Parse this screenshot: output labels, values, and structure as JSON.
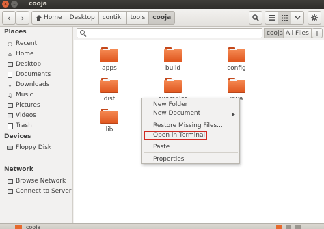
{
  "window": {
    "title": "cooja"
  },
  "toolbar": {
    "back_icon": "back-arrow-icon",
    "forward_icon": "forward-arrow-icon",
    "breadcrumbs": [
      "Home",
      "Desktop",
      "contiki",
      "tools",
      "cooja"
    ],
    "search_icon": "search-icon",
    "list_view_icon": "list-view-icon",
    "grid_view_icon": "grid-view-icon",
    "dropdown_icon": "chevron-down-icon",
    "settings_icon": "gear-icon"
  },
  "sidebar": {
    "places_title": "Places",
    "places": [
      {
        "label": "Recent",
        "icon": "clock-icon"
      },
      {
        "label": "Home",
        "icon": "home-icon"
      },
      {
        "label": "Desktop",
        "icon": "desktop-icon"
      },
      {
        "label": "Documents",
        "icon": "documents-icon"
      },
      {
        "label": "Downloads",
        "icon": "downloads-icon"
      },
      {
        "label": "Music",
        "icon": "music-icon"
      },
      {
        "label": "Pictures",
        "icon": "pictures-icon"
      },
      {
        "label": "Videos",
        "icon": "videos-icon"
      },
      {
        "label": "Trash",
        "icon": "trash-icon"
      }
    ],
    "devices_title": "Devices",
    "devices": [
      {
        "label": "Floppy Disk",
        "icon": "floppy-icon"
      }
    ],
    "network_title": "Network",
    "network": [
      {
        "label": "Browse Network",
        "icon": "network-icon"
      },
      {
        "label": "Connect to Server",
        "icon": "server-icon"
      }
    ]
  },
  "search": {
    "placeholder": "",
    "scopes": [
      "cooja",
      "All Files"
    ],
    "selected_scope": "cooja"
  },
  "folders": [
    "apps",
    "build",
    "config",
    "dist",
    "examples",
    "java",
    "lib"
  ],
  "context_menu": {
    "items": [
      {
        "label": "New Folder",
        "submenu": false
      },
      {
        "label": "New Document",
        "submenu": true
      },
      {
        "label": "Restore Missing Files...",
        "submenu": false
      },
      {
        "label": "Open in Terminal",
        "submenu": false,
        "highlighted": true
      },
      {
        "label": "Paste",
        "submenu": false
      },
      {
        "label": "Properties",
        "submenu": false
      }
    ]
  },
  "taskbar": {
    "items": [
      "cooja"
    ]
  },
  "colors": {
    "folder": "#e66a2e",
    "highlight_border": "#d12b22",
    "titlebar": "#3c3b37"
  }
}
